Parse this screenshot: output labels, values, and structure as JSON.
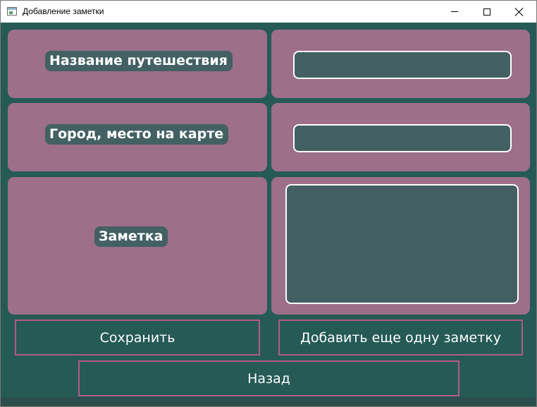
{
  "window": {
    "title": "Добавление заметки",
    "icon": "app-window-icon",
    "controls": [
      "minimize-icon",
      "maximize-icon",
      "close-icon"
    ]
  },
  "form": {
    "trip_name_label": "Название путешествия",
    "trip_name_value": "",
    "place_label": "Город, место на карте",
    "place_value": "",
    "note_label": "Заметка",
    "note_value": ""
  },
  "buttons": {
    "save": "Сохранить",
    "add_another": "Добавить еще одну заметку",
    "back": "Назад"
  },
  "colors": {
    "background": "#255a55",
    "card": "#9d6f89",
    "field": "#436063",
    "button_border": "#b55a86",
    "text": "#ffffff"
  }
}
